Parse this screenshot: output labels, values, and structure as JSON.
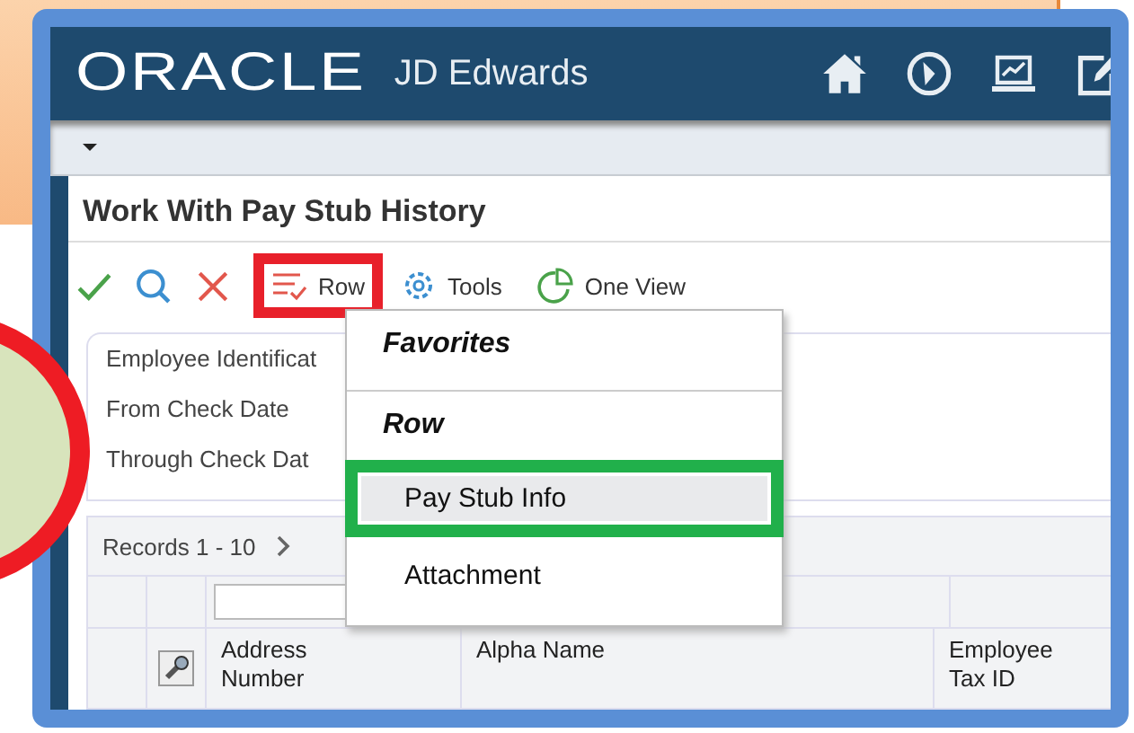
{
  "header": {
    "logo": "ORACLE",
    "product": "JD Edwards",
    "icons": [
      {
        "kind": "home"
      },
      {
        "kind": "compass"
      },
      {
        "kind": "monitor"
      },
      {
        "kind": "edit"
      }
    ]
  },
  "form": {
    "title": "Work With Pay Stub History"
  },
  "toolbar": [
    {
      "kind": "check"
    },
    {
      "kind": "search"
    },
    {
      "kind": "close"
    },
    {
      "kind": "menu",
      "label": "Row",
      "annotated": true
    },
    {
      "kind": "gear",
      "label": "Tools",
      "annotated": false
    },
    {
      "kind": "pie",
      "label": "One View",
      "annotated": false
    }
  ],
  "filters": [
    {
      "label": "Employee Identificat"
    },
    {
      "label": "From Check Date"
    },
    {
      "label": "Through Check Dat"
    }
  ],
  "grid": {
    "records": "Records 1 - 10",
    "columns": [
      {
        "label": "Address Number"
      },
      {
        "label": "Alpha Name"
      },
      {
        "label": "Employee Tax ID"
      }
    ]
  },
  "menu": {
    "sections": [
      {
        "heading": "Favorites"
      },
      {
        "heading": "Row",
        "items": [
          {
            "label": "Pay Stub Info",
            "selected": true,
            "annotated": true
          },
          {
            "label": "Attachment",
            "selected": false,
            "annotated": false
          }
        ]
      }
    ]
  }
}
